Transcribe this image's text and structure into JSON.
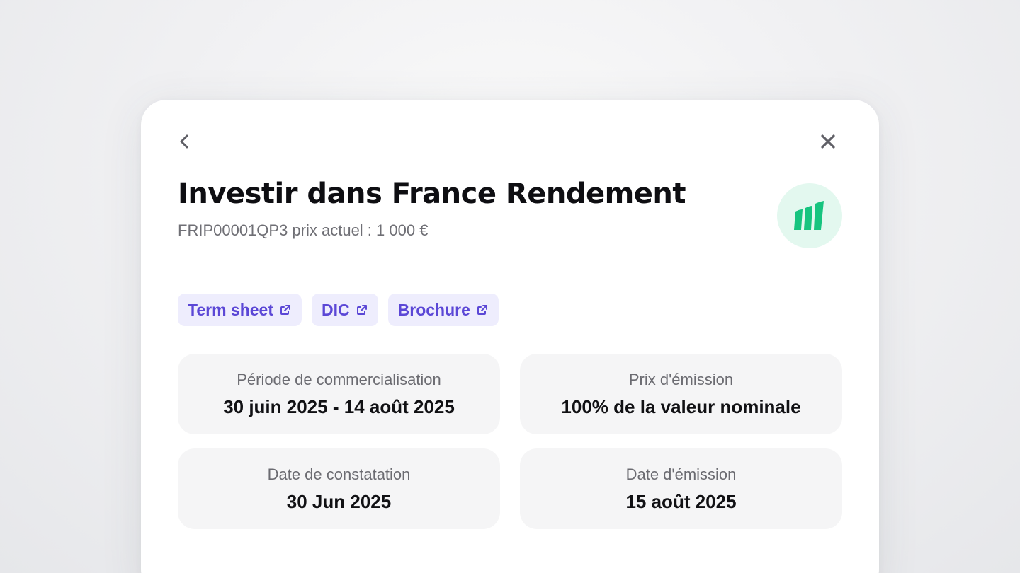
{
  "header": {
    "back_icon": "chevron-left-icon",
    "close_icon": "close-icon"
  },
  "title": "Investir dans France Rendement",
  "subtitle": "FRIP00001QP3 prix actuel : 1 000 €",
  "logo": {
    "icon": "brand-logo-icon",
    "accent_color": "#16c47f",
    "background_color": "#e3f8ef"
  },
  "documents": [
    {
      "label": "Term sheet",
      "icon": "external-link-icon"
    },
    {
      "label": "DIC",
      "icon": "external-link-icon"
    },
    {
      "label": "Brochure",
      "icon": "external-link-icon"
    }
  ],
  "link_color": "#5b47d6",
  "details": [
    {
      "label": "Période de commercialisation",
      "value": "30 juin 2025 - 14 août 2025"
    },
    {
      "label": "Prix d'émission",
      "value": "100% de la valeur nominale"
    },
    {
      "label": "Date de constatation",
      "value": "30 Jun 2025"
    },
    {
      "label": "Date d'émission",
      "value": "15 août 2025"
    }
  ]
}
